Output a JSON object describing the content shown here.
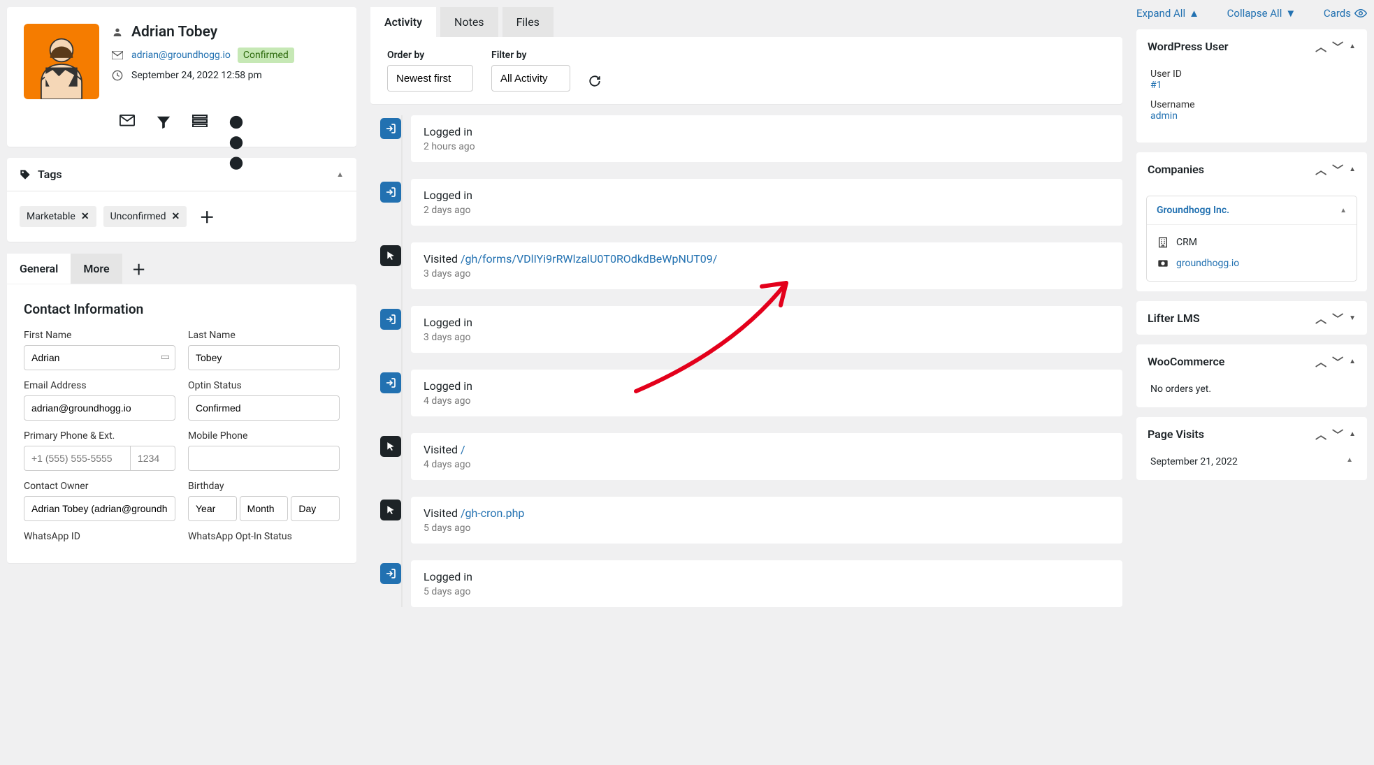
{
  "profile": {
    "name": "Adrian Tobey",
    "email": "adrian@groundhogg.io",
    "status": "Confirmed",
    "datetime": "September 24, 2022 12:58 pm"
  },
  "tags": {
    "title": "Tags",
    "items": [
      "Marketable",
      "Unconfirmed"
    ]
  },
  "detail_tabs": {
    "general": "General",
    "more": "More"
  },
  "contact_form": {
    "heading": "Contact Information",
    "first_name_label": "First Name",
    "first_name": "Adrian",
    "last_name_label": "Last Name",
    "last_name": "Tobey",
    "email_label": "Email Address",
    "email": "adrian@groundhogg.io",
    "optin_label": "Optin Status",
    "optin": "Confirmed",
    "phone_label": "Primary Phone & Ext.",
    "phone_placeholder": "+1 (555) 555-5555",
    "ext_placeholder": "1234",
    "mobile_label": "Mobile Phone",
    "owner_label": "Contact Owner",
    "owner": "Adrian Tobey (adrian@groundhogg.io)",
    "birthday_label": "Birthday",
    "year": "Year",
    "month": "Month",
    "day": "Day",
    "whatsapp_id_label": "WhatsApp ID",
    "whatsapp_optin_label": "WhatsApp Opt-In Status"
  },
  "activity_tabs": {
    "activity": "Activity",
    "notes": "Notes",
    "files": "Files"
  },
  "filters": {
    "order_by_label": "Order by",
    "order_by": "Newest first",
    "filter_by_label": "Filter by",
    "filter_by": "All Activity"
  },
  "timeline": [
    {
      "type": "login",
      "title_a": "Logged in",
      "path": "",
      "time": "2 hours ago"
    },
    {
      "type": "login",
      "title_a": "Logged in",
      "path": "",
      "time": "2 days ago"
    },
    {
      "type": "visit",
      "title_a": "Visited ",
      "path": "/gh/forms/VDlIYi9rRWlzalU0T0ROdkdBeWpNUT09/",
      "time": "3 days ago"
    },
    {
      "type": "login",
      "title_a": "Logged in",
      "path": "",
      "time": "3 days ago"
    },
    {
      "type": "login",
      "title_a": "Logged in",
      "path": "",
      "time": "4 days ago"
    },
    {
      "type": "visit",
      "title_a": "Visited ",
      "path": "/",
      "time": "4 days ago"
    },
    {
      "type": "visit",
      "title_a": "Visited ",
      "path": "/gh-cron.php",
      "time": "5 days ago"
    },
    {
      "type": "login",
      "title_a": "Logged in",
      "path": "",
      "time": "5 days ago"
    }
  ],
  "right_controls": {
    "expand": "Expand All",
    "collapse": "Collapse All",
    "cards": "Cards"
  },
  "wp_user": {
    "title": "WordPress User",
    "user_id_label": "User ID",
    "user_id": "#1",
    "username_label": "Username",
    "username": "admin"
  },
  "companies": {
    "title": "Companies",
    "company_name": "Groundhogg Inc.",
    "type": "CRM",
    "url": "groundhogg.io"
  },
  "lifter": {
    "title": "Lifter LMS"
  },
  "woo": {
    "title": "WooCommerce",
    "empty": "No orders yet."
  },
  "page_visits": {
    "title": "Page Visits",
    "date": "September 21, 2022"
  }
}
